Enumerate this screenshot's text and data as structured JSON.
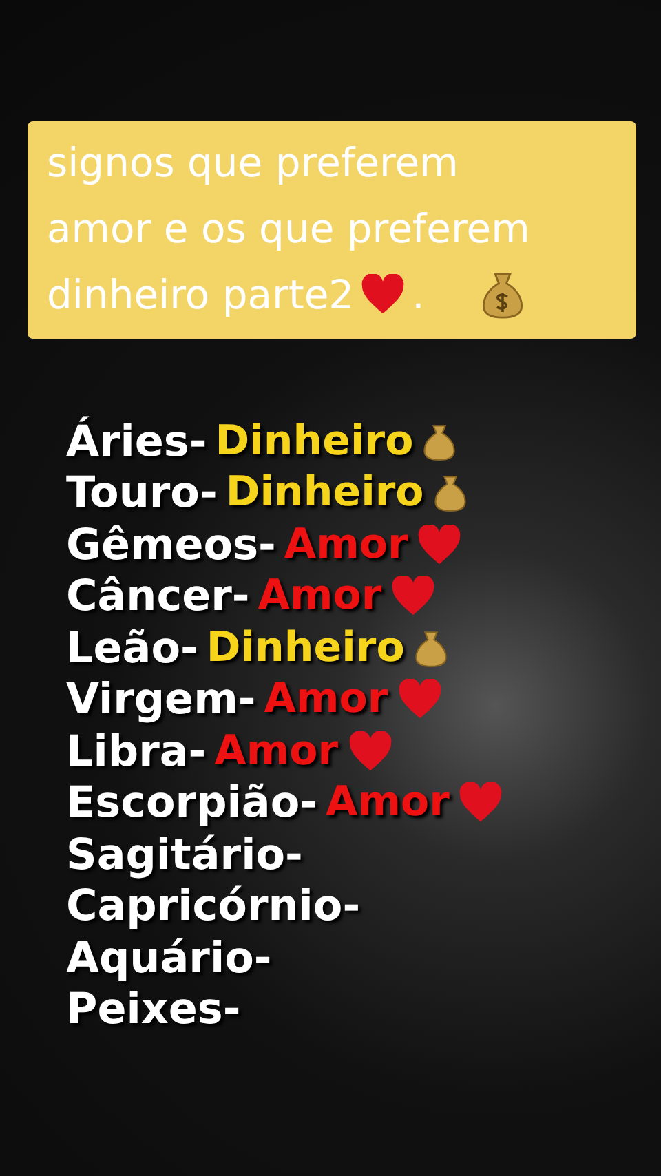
{
  "caption": {
    "lines": [
      "signos que preferem",
      "amor e os que preferem",
      "dinheiro parte2"
    ],
    "end_mark": "."
  },
  "signs": [
    {
      "name": "Áries-",
      "choice": {
        "kind": "money",
        "label": "Dinheiro"
      }
    },
    {
      "name": "Touro-",
      "choice": {
        "kind": "money",
        "label": "Dinheiro"
      }
    },
    {
      "name": "Gêmeos-",
      "choice": {
        "kind": "love",
        "label": "Amor"
      }
    },
    {
      "name": "Câncer-",
      "choice": {
        "kind": "love",
        "label": "Amor"
      }
    },
    {
      "name": "Leão-",
      "choice": {
        "kind": "money",
        "label": "Dinheiro"
      }
    },
    {
      "name": "Virgem-",
      "choice": {
        "kind": "love",
        "label": "Amor"
      }
    },
    {
      "name": "Libra-",
      "choice": {
        "kind": "love",
        "label": "Amor"
      }
    },
    {
      "name": "Escorpião-",
      "choice": {
        "kind": "love",
        "label": "Amor"
      }
    },
    {
      "name": "Sagitário-"
    },
    {
      "name": "Capricórnio-"
    },
    {
      "name": "Aquário-"
    },
    {
      "name": "Peixes-"
    }
  ]
}
